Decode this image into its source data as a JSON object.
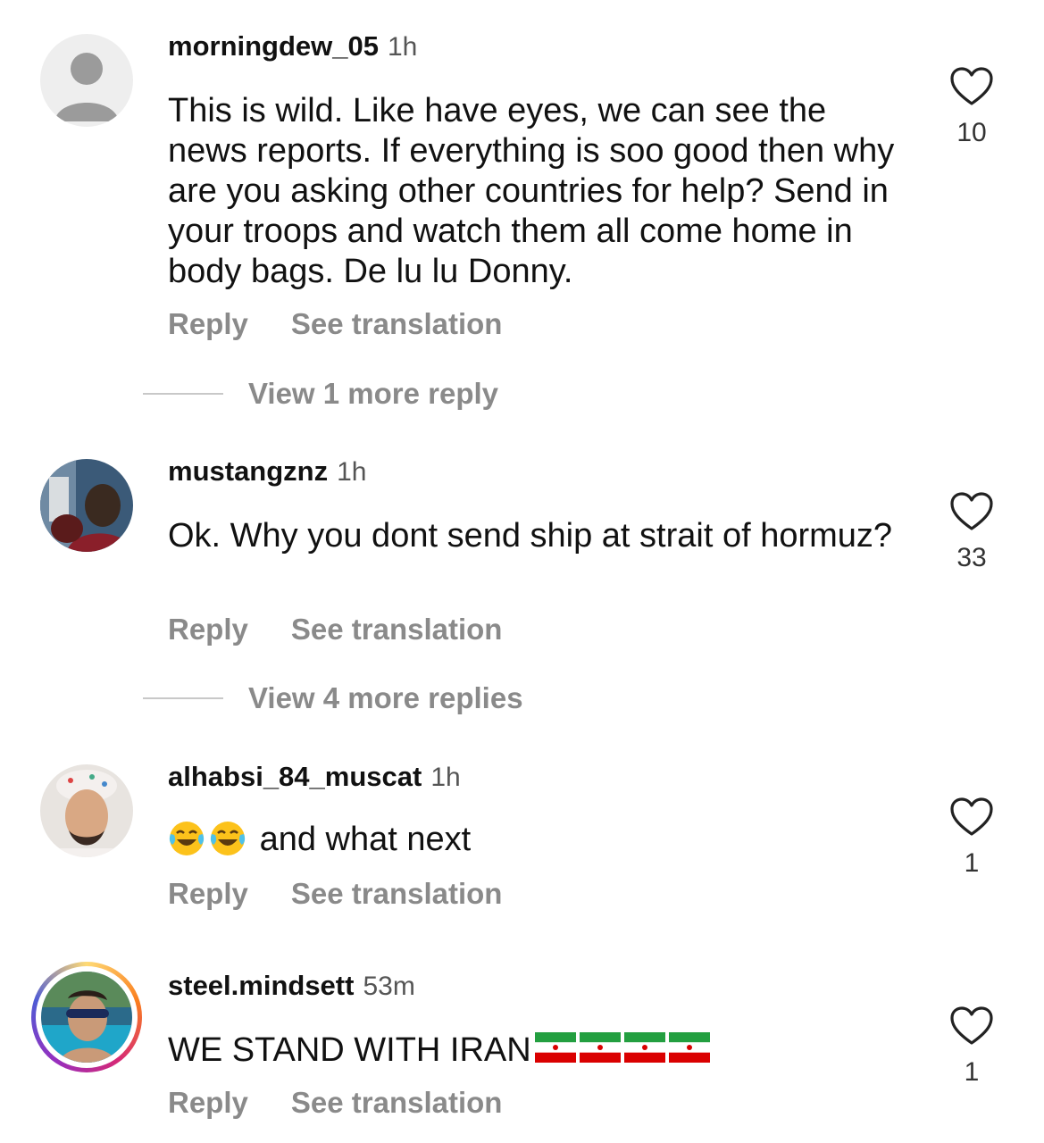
{
  "comments": [
    {
      "username": "morningdew_05",
      "time": "1h",
      "text": "This is wild. Like have eyes, we can see the news reports. If everything is soo good then why are you asking other countries for help? Send in your troops and watch them all come home in body bags. De lu lu Donny.",
      "likes": "10",
      "reply_label": "Reply",
      "translate_label": "See translation",
      "view_more": "View 1 more reply",
      "avatar": "default-avatar-icon"
    },
    {
      "username": "mustangznz",
      "time": "1h",
      "text": "Ok. Why you dont send ship at strait of hormuz?",
      "likes": "33",
      "reply_label": "Reply",
      "translate_label": "See translation",
      "view_more": "View 4 more replies",
      "avatar": "user-photo"
    },
    {
      "username": "alhabsi_84_muscat",
      "time": "1h",
      "text": "and what next",
      "emoji": [
        "face-with-tears-of-joy",
        "face-with-tears-of-joy"
      ],
      "likes": "1",
      "reply_label": "Reply",
      "translate_label": "See translation",
      "avatar": "user-photo"
    },
    {
      "username": "steel.mindsett",
      "time": "53m",
      "text": "WE STAND WITH IRAN",
      "emoji": [
        "iran-flag",
        "iran-flag",
        "iran-flag",
        "iran-flag"
      ],
      "likes": "1",
      "reply_label": "Reply",
      "translate_label": "See translation",
      "avatar": "user-photo-story-ring"
    }
  ],
  "colors": {
    "text": "#111111",
    "muted": "#8a8a8a",
    "divider": "#c8c8c8",
    "heart_stroke": "#222222"
  }
}
